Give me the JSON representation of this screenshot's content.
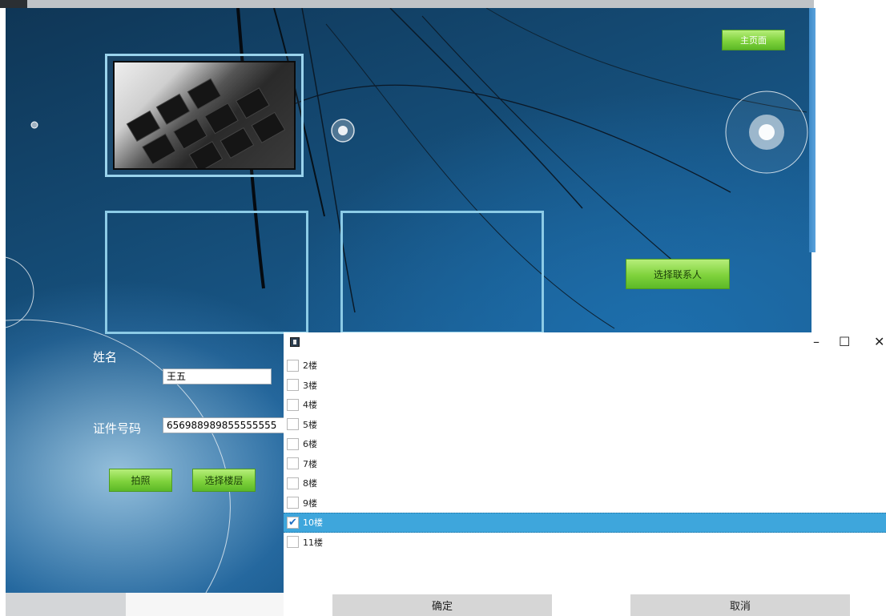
{
  "main": {
    "home_label": "主页面",
    "select_contact_label": "选择联系人",
    "name_label": "姓名",
    "name_value": "王五",
    "id_label": "证件号码",
    "id_value": "656988989855555555",
    "photo_button_label": "拍照",
    "select_floor_label": "选择楼层"
  },
  "dialog": {
    "floors": [
      {
        "label": "2楼",
        "checked": false
      },
      {
        "label": "3楼",
        "checked": false
      },
      {
        "label": "4楼",
        "checked": false
      },
      {
        "label": "5楼",
        "checked": false
      },
      {
        "label": "6楼",
        "checked": false
      },
      {
        "label": "7楼",
        "checked": false
      },
      {
        "label": "8楼",
        "checked": false
      },
      {
        "label": "9楼",
        "checked": false
      },
      {
        "label": "10楼",
        "checked": true
      },
      {
        "label": "11楼",
        "checked": false
      }
    ],
    "ok_label": "确定",
    "cancel_label": "取消",
    "minimize_glyph": "–",
    "maximize_glyph": "☐",
    "close_glyph": "✕",
    "check_glyph": "✔"
  },
  "colors": {
    "accent_green": "#7fd23c",
    "selection_blue": "#3ea6dc",
    "frame_border": "#9ad3ec"
  }
}
